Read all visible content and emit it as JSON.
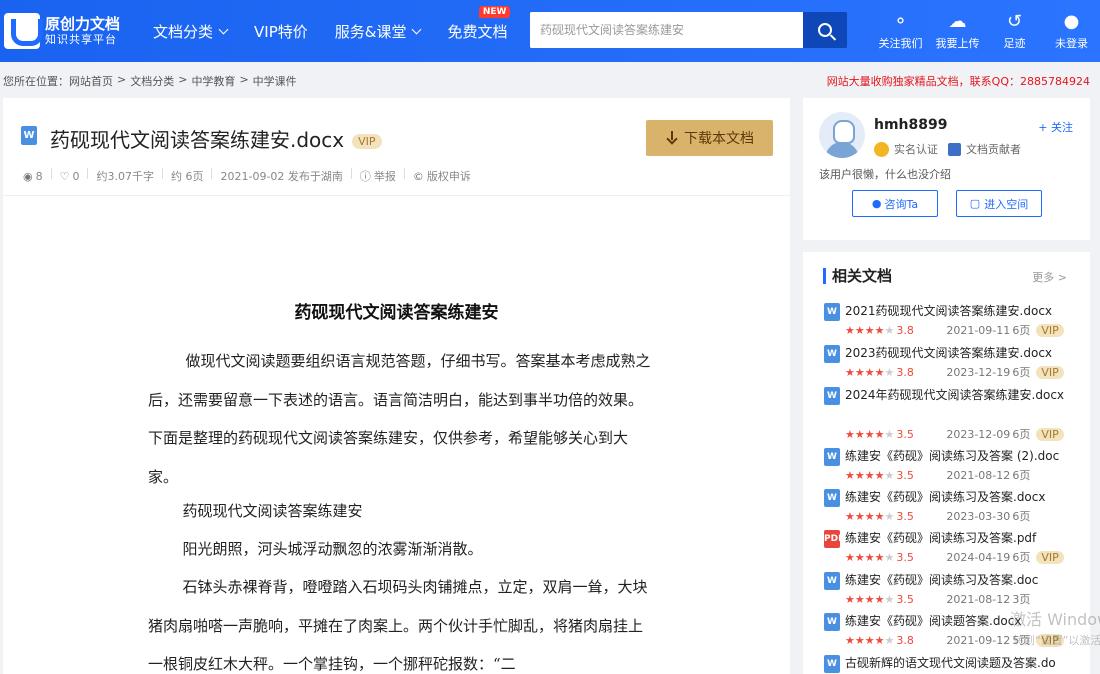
{
  "header": {
    "logo_title": "原创力文档",
    "logo_sub": "知识共享平台",
    "nav": [
      {
        "label": "文档分类",
        "chevron": true
      },
      {
        "label": "VIP特价",
        "chevron": false
      },
      {
        "label": "服务&课堂",
        "chevron": true
      },
      {
        "label": "免费文档",
        "chevron": false,
        "badge": "NEW"
      }
    ],
    "search_placeholder": "药砚现代文阅读答案练建安",
    "icons": [
      {
        "label": "关注我们",
        "icon": "wechat-icon"
      },
      {
        "label": "我要上传",
        "icon": "upload-cloud-icon"
      },
      {
        "label": "足迹",
        "icon": "history-icon"
      },
      {
        "label": "未登录",
        "icon": "user-icon"
      }
    ],
    "brand_color": "#1f6bff"
  },
  "breadcrumb": {
    "prefix": "您所在位置：",
    "items": [
      "网站首页",
      "文档分类",
      "中学教育",
      "中学课件"
    ]
  },
  "notice": "网站大量收购独家精品文档，联系QQ：2885784924",
  "doc": {
    "file_type": "W",
    "title": "药砚现代文阅读答案练建安.docx",
    "vip": "VIP",
    "download_label": "下载本文档",
    "meta": {
      "views": "8",
      "likes": "0",
      "words": "约3.07千字",
      "pages": "约 6页",
      "published": "2021-09-02 发布于湖南",
      "report": "举报",
      "copyright": "版权申诉"
    },
    "body_title": "药砚现代文阅读答案练建安",
    "paragraphs": [
      "做现代文阅读题要组织语言规范答题，仔细书写。答案基本考虑成熟之后，还需要留意一下表述的语言。语言简洁明白，能达到事半功倍的效果。下面是整理的药砚现代文阅读答案练建安，仅供参考，希望能够关心到大家。",
      "药砚现代文阅读答案练建安",
      "阳光朗照，河头城浮动飘忽的浓雾渐渐消散。",
      "石钵头赤裸脊背，噔噔踏入石坝码头肉铺摊点，立定，双肩一耸，大块猪肉扇啪嗒一声脆响，平摊在了肉案上。两个伙计手忙脚乱，将猪肉扇挂上一根铜皮红木大秤。一个掌挂钩，一个挪秤砣报数：“二"
    ]
  },
  "uploader": {
    "name": "hmh8899",
    "follow": "+ 关注",
    "badge_verified": "实名认证",
    "badge_contrib": "文档贡献者",
    "signature": "该用户很懒，什么也没介绍",
    "ask_label": "咨询Ta",
    "space_label": "进入空间"
  },
  "related": {
    "title": "相关文档",
    "more": "更多 >",
    "items": [
      {
        "type": "W",
        "name": "2021药砚现代文阅读答案练建安.docx",
        "stars": 4,
        "score": "3.8",
        "date": "2021-09-11",
        "pages": "6页",
        "vip": "VIP"
      },
      {
        "type": "W",
        "name": "2023药砚现代文阅读答案练建安.docx",
        "stars": 4,
        "score": "3.8",
        "date": "2023-12-19",
        "pages": "6页",
        "vip": "VIP"
      },
      {
        "type": "W",
        "name": "2024年药砚现代文阅读答案练建安.docx",
        "stars": 3.5,
        "score": "3.5",
        "date": "2023-12-09",
        "pages": "6页",
        "vip": "VIP"
      },
      {
        "type": "W",
        "name": "练建安《药砚》阅读练习及答案 (2).doc",
        "stars": 3.5,
        "score": "3.5",
        "date": "2021-08-12",
        "pages": "6页",
        "vip": ""
      },
      {
        "type": "W",
        "name": "练建安《药砚》阅读练习及答案.docx",
        "stars": 3.5,
        "score": "3.5",
        "date": "2023-03-30",
        "pages": "6页",
        "vip": ""
      },
      {
        "type": "PDF",
        "name": "练建安《药砚》阅读练习及答案.pdf",
        "stars": 3.5,
        "score": "3.5",
        "date": "2024-04-19",
        "pages": "6页",
        "vip": "VIP"
      },
      {
        "type": "W",
        "name": "练建安《药砚》阅读练习及答案.doc",
        "stars": 3.5,
        "score": "3.5",
        "date": "2021-08-12",
        "pages": "3页",
        "vip": ""
      },
      {
        "type": "W",
        "name": "练建安《药砚》阅读题答案.docx",
        "stars": 4,
        "score": "3.8",
        "date": "2021-09-12",
        "pages": "5页",
        "vip": "VIP"
      },
      {
        "type": "W",
        "name": "古砚新辉的语文现代文阅读题及答案.do",
        "stars": 0,
        "score": "",
        "date": "",
        "pages": "",
        "vip": ""
      }
    ]
  },
  "watermark": {
    "line1": "激活 Windows",
    "line2": "转到“设置”以激活 Windows。"
  }
}
